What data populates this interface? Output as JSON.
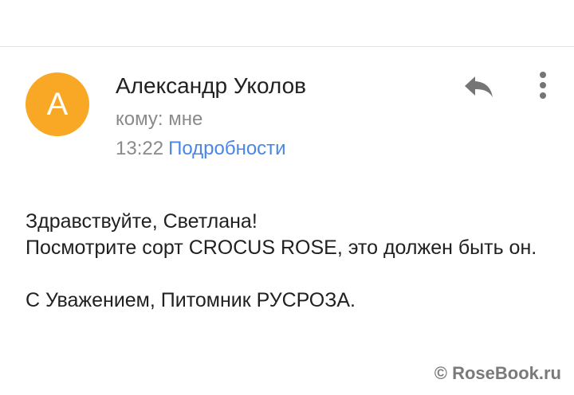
{
  "sender": {
    "avatar_letter": "А",
    "avatar_color": "#f9a825",
    "name": "Александр Уколов"
  },
  "recipient": {
    "label": "кому: мне"
  },
  "meta": {
    "time": "13:22",
    "details_link": "Подробности",
    "link_color": "#4a86e8"
  },
  "actions": {
    "reply_icon": "reply-icon",
    "more_icon": "more-vert-icon"
  },
  "body": {
    "greeting": "Здравствуйте, Светлана!",
    "line1": "Посмотрите сорт CROCUS ROSE, это должен быть он.",
    "signature": "С Уважением, Питомник РУСРОЗА."
  },
  "watermark": "© RoseBook.ru"
}
